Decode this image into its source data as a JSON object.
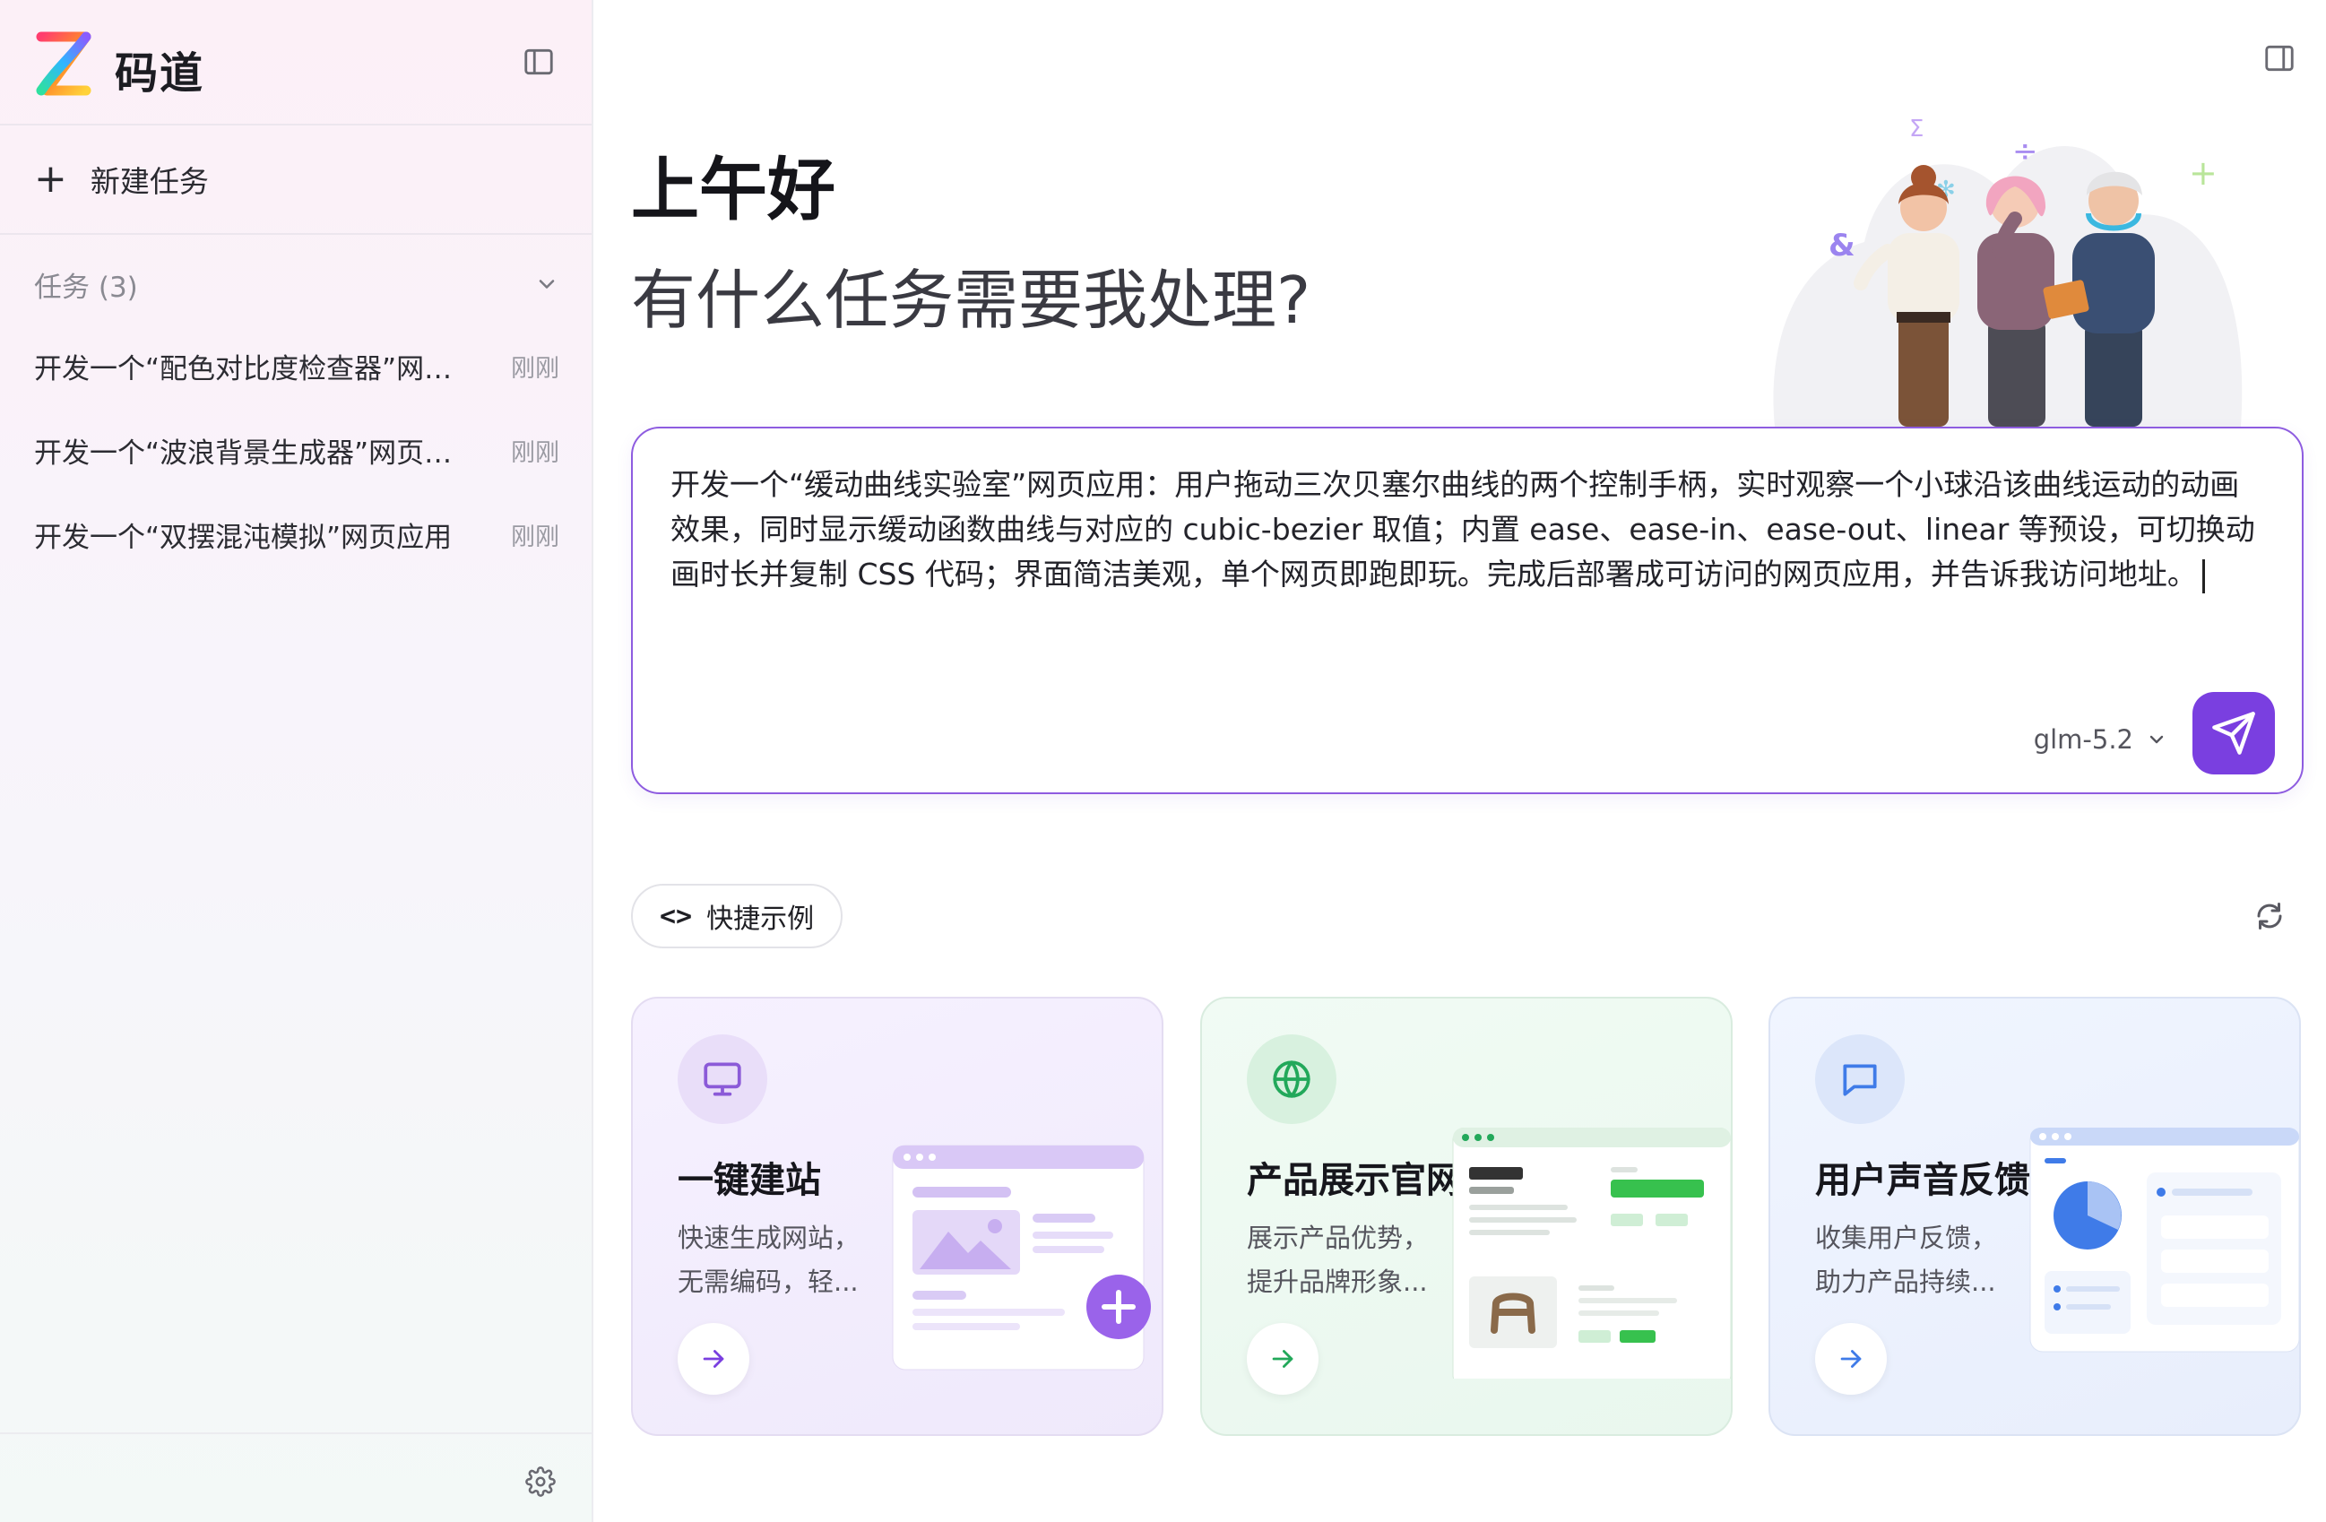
{
  "sidebar": {
    "brand": "码道",
    "new_task": "新建任务",
    "tasks_header": "任务 (3)",
    "tasks": [
      {
        "title": "开发一个“配色对比度检查器”网页应用",
        "time": "刚刚"
      },
      {
        "title": "开发一个“波浪背景生成器”网页应用",
        "time": "刚刚"
      },
      {
        "title": "开发一个“双摆混沌模拟”网页应用",
        "time": "刚刚"
      }
    ]
  },
  "main": {
    "greeting": "上午好",
    "question": "有什么任务需要我处理?",
    "prompt_text": "开发一个“缓动曲线实验室”网页应用：用户拖动三次贝塞尔曲线的两个控制手柄，实时观察一个小球沿该曲线运动的动画效果，同时显示缓动函数曲线与对应的 cubic-bezier 取值；内置 ease、ease-in、ease-out、linear 等预设，可切换动画时长并复制 CSS 代码；界面简洁美观，单个网页即跑即玩。完成后部署成可访问的网页应用，并告诉我访问地址。",
    "model": "glm-5.2",
    "quick_examples": "快捷示例",
    "quick_code_glyph": "<>",
    "cards": [
      {
        "title": "一键建站",
        "desc1": "快速生成网站，",
        "desc2": "无需编码，轻..."
      },
      {
        "title": "产品展示官网",
        "desc1": "展示产品优势，",
        "desc2": "提升品牌形象..."
      },
      {
        "title": "用户声音反馈",
        "desc1": "收集用户反馈，",
        "desc2": "助力产品持续..."
      }
    ]
  },
  "colors": {
    "accent": "#7a3fe0",
    "card1": "#f3eefd",
    "card2": "#edf9f1",
    "card3": "#ecf2fe"
  },
  "icons": {
    "logo": "brand-logo-icon",
    "sidebar_toggle": "sidebar-panel-icon",
    "settings": "gear-icon",
    "send": "send-icon",
    "refresh": "refresh-icon"
  }
}
